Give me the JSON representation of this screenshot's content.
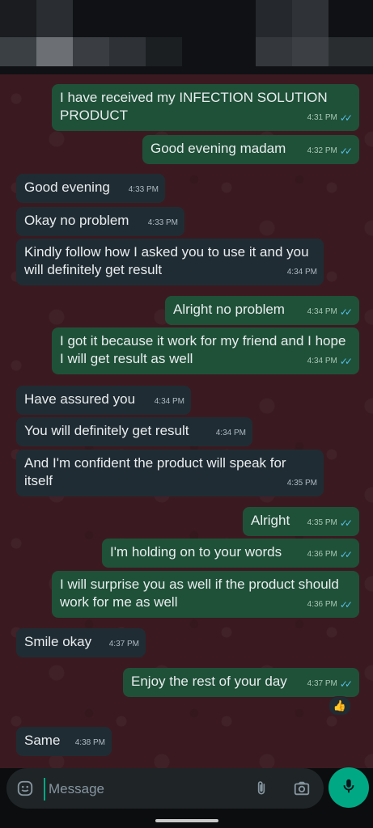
{
  "input": {
    "placeholder": "Message"
  },
  "icons": {
    "emoji": "emoji-icon",
    "attach": "paperclip-icon",
    "camera": "camera-icon",
    "mic": "mic-icon",
    "reaction": "thumbs-up"
  },
  "colors": {
    "outgoing": "#1f5138",
    "incoming": "#202c33",
    "accent": "#00a884",
    "ticks": "#53bdeb"
  },
  "messages": [
    {
      "dir": "out",
      "text": "I have received my INFECTION SOLUTION PRODUCT",
      "time": "4:31 PM",
      "ticks": "✓✓"
    },
    {
      "dir": "out",
      "text": "Good evening madam",
      "time": "4:32 PM",
      "ticks": "✓✓"
    },
    {
      "dir": "in",
      "text": "Good evening",
      "time": "4:33 PM"
    },
    {
      "dir": "in",
      "text": "Okay no problem",
      "time": "4:33 PM"
    },
    {
      "dir": "in",
      "text": "Kindly follow how I asked you to use it and you will definitely get result",
      "time": "4:34 PM"
    },
    {
      "dir": "out",
      "text": "Alright no problem",
      "time": "4:34 PM",
      "ticks": "✓✓"
    },
    {
      "dir": "out",
      "text": "I got it because it work for my friend and I hope I will get result as well",
      "time": "4:34 PM",
      "ticks": "✓✓"
    },
    {
      "dir": "in",
      "text": "Have assured you",
      "time": "4:34 PM"
    },
    {
      "dir": "in",
      "text": "You will definitely get result",
      "time": "4:34 PM"
    },
    {
      "dir": "in",
      "text": "And I'm confident the product will speak for itself",
      "time": "4:35 PM"
    },
    {
      "dir": "out",
      "text": "Alright",
      "time": "4:35 PM",
      "ticks": "✓✓"
    },
    {
      "dir": "out",
      "text": "I'm holding on to your words",
      "time": "4:36 PM",
      "ticks": "✓✓"
    },
    {
      "dir": "out",
      "text": "I will surprise you as well if the product should work for me as well",
      "time": "4:36 PM",
      "ticks": "✓✓"
    },
    {
      "dir": "in",
      "text": "Smile okay",
      "time": "4:37 PM"
    },
    {
      "dir": "out",
      "text": "Enjoy the rest of your day",
      "time": "4:37 PM",
      "ticks": "✓✓",
      "reaction": "👍"
    },
    {
      "dir": "in",
      "text": "Same",
      "time": "4:38 PM"
    }
  ]
}
